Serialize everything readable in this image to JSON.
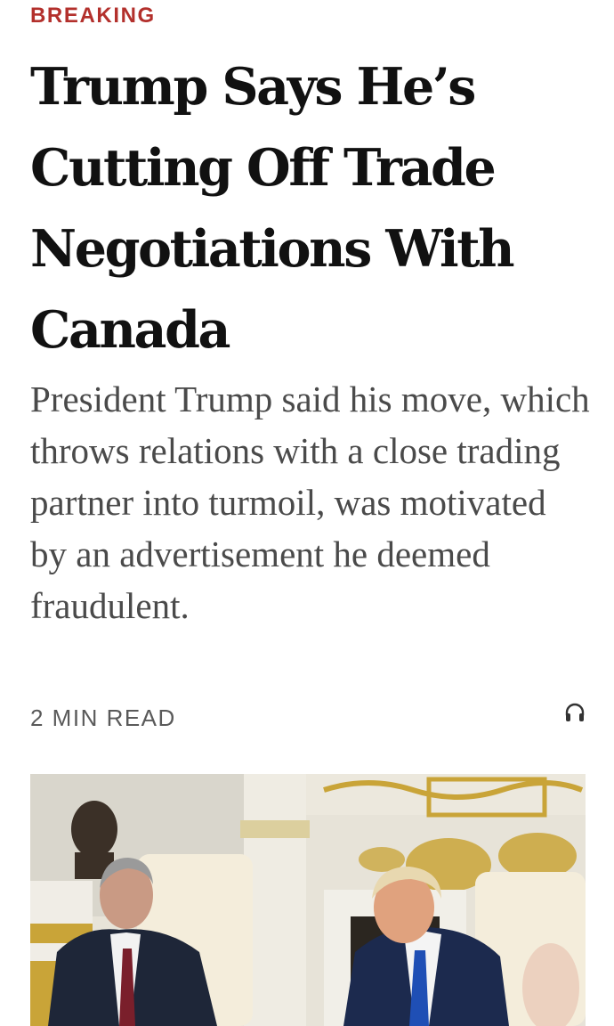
{
  "article": {
    "kicker": "BREAKING",
    "headline": "Trump Says He’s Cutting Off Trade Negotiations With Canada",
    "summary": "President Trump said his move, which throws relations with a close trading partner into turmoil, was motivated by an advertisement he deemed fraudulent.",
    "read_time": "2 MIN READ",
    "listen_icon": "headphones-icon"
  },
  "colors": {
    "kicker": "#b3302c",
    "headline": "#111111",
    "summary": "#4a4a4a",
    "meta": "#5a5a5a"
  }
}
